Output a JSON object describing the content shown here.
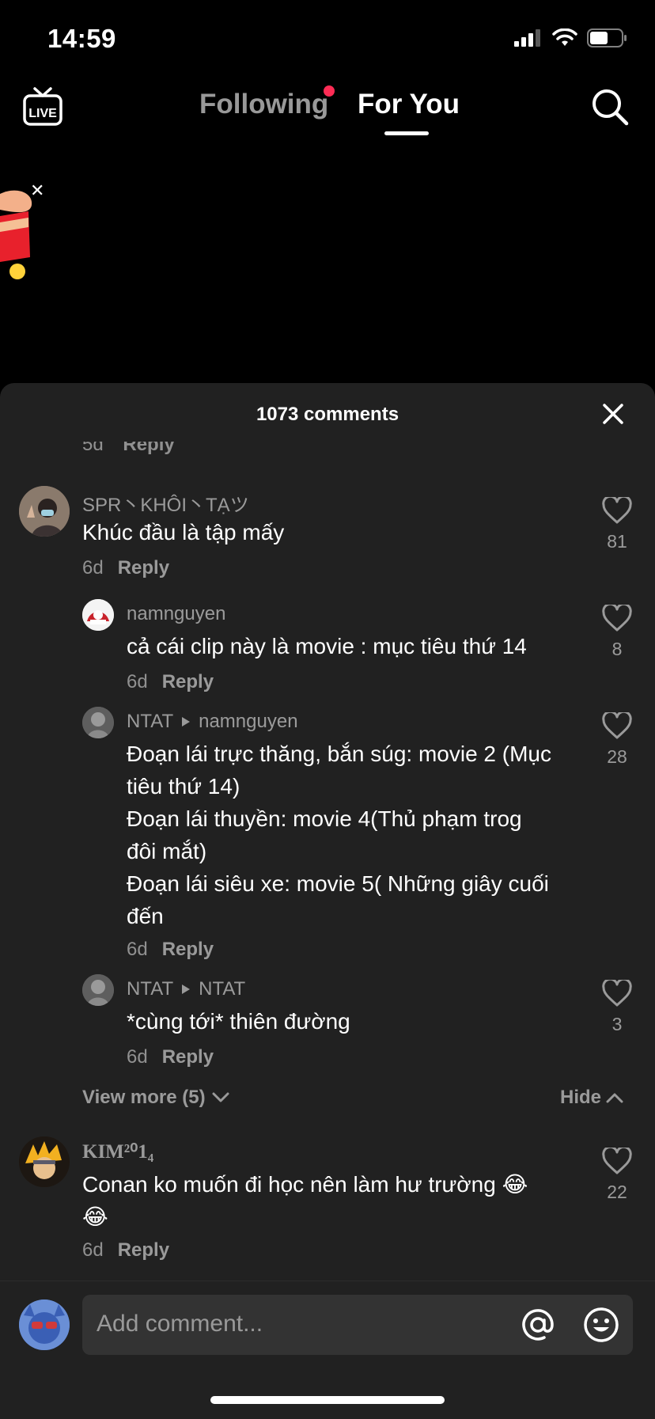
{
  "status": {
    "time": "14:59"
  },
  "nav": {
    "live_label": "LIVE",
    "following": "Following",
    "for_you": "For You"
  },
  "comments_sheet": {
    "title": "1073 comments",
    "partial_meta": {
      "time": "5d",
      "reply": "Reply"
    },
    "comments": [
      {
        "user": "SPR丶KHÔI丶TẠツ",
        "text": "Khúc đầu là tập mấy",
        "time": "6d",
        "reply": "Reply",
        "likes": "81"
      },
      {
        "user": "namnguyen",
        "text": "cả cái clip này là movie : mục tiêu thứ 14",
        "time": "6d",
        "reply": "Reply",
        "likes": "8"
      },
      {
        "user": "NTAT",
        "reply_to": "namnguyen",
        "text_lines": [
          "Đoạn lái trực thăng, bắn súg: movie 2 (Mục",
          "tiêu thứ 14)",
          "Đoạn lái thuyền: movie 4(Thủ phạm trog",
          "đôi mắt)",
          "Đoạn lái siêu xe: movie 5( Những giây cuối",
          "đến"
        ],
        "time": "6d",
        "reply": "Reply",
        "likes": "28"
      },
      {
        "user": "NTAT",
        "reply_to": "NTAT",
        "text": "*cùng tới* thiên đường",
        "time": "6d",
        "reply": "Reply",
        "likes": "3"
      },
      {
        "user": "KIM²⁰1₄",
        "text_lines": [
          "Conan ko muốn đi học nên làm hư trường 😂",
          "😂"
        ],
        "time": "6d",
        "reply": "Reply",
        "likes": "22"
      }
    ],
    "view_more": "View more (5)",
    "hide": "Hide"
  },
  "composer": {
    "placeholder": "Add comment..."
  },
  "colors": {
    "accent_red": "#fe2c55",
    "sheet_bg": "#212121",
    "input_bg": "#333333"
  },
  "icons": [
    "live-icon",
    "search-icon",
    "close-icon",
    "heart-icon",
    "chevron-down-icon",
    "chevron-up-icon",
    "at-icon",
    "emoji-icon",
    "gift-icon"
  ]
}
